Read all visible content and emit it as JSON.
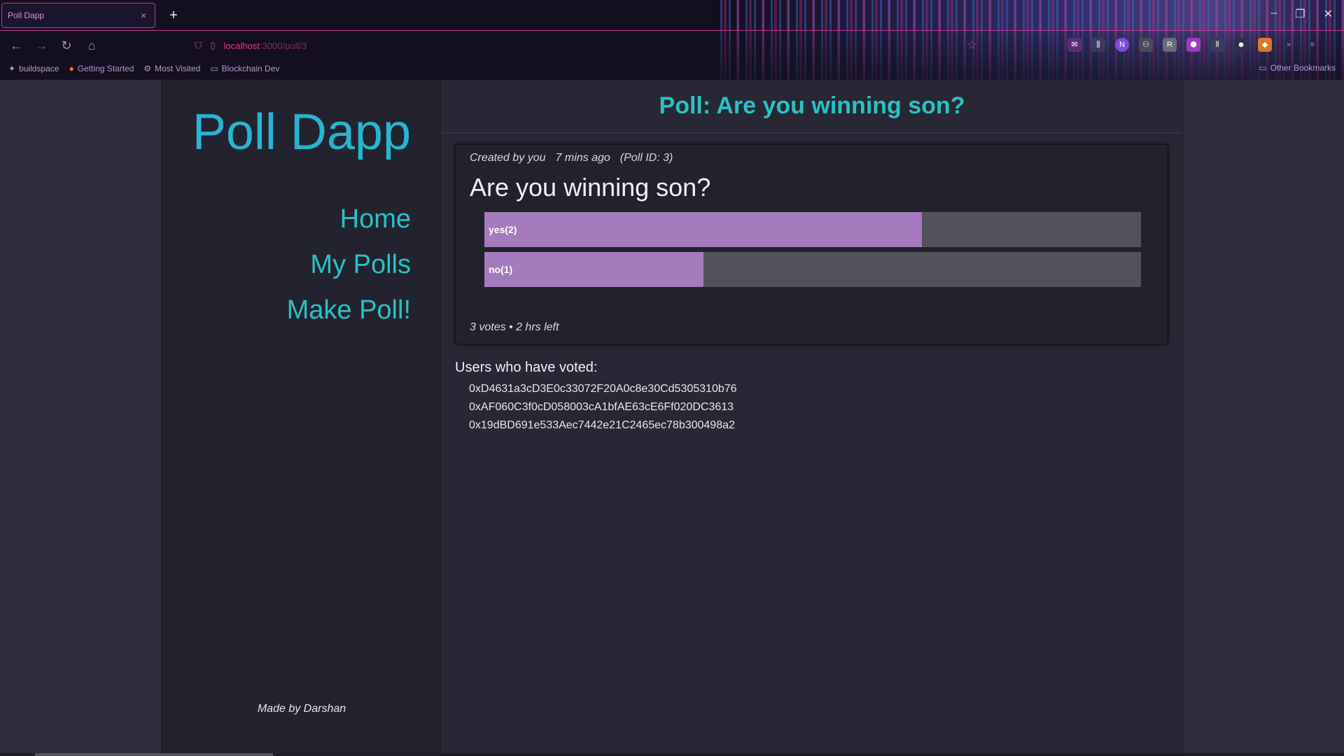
{
  "browser": {
    "tab_title": "Poll Dapp",
    "tab_close": "×",
    "new_tab": "+",
    "url_host": "localhost",
    "url_path": ":3000/poll/3",
    "bookmarks": [
      {
        "label": "buildspace",
        "icon": "unicorn-icon"
      },
      {
        "label": "Getting Started",
        "icon": "firefox-icon"
      },
      {
        "label": "Most Visited",
        "icon": "gear-icon"
      },
      {
        "label": "Blockchain Dev",
        "icon": "folder-icon"
      }
    ],
    "other_bookmarks": "Other Bookmarks",
    "accent": "#c23a8f"
  },
  "sidebar": {
    "brand": "Poll Dapp",
    "nav": [
      {
        "label": "Home"
      },
      {
        "label": "My Polls"
      },
      {
        "label": "Make Poll!"
      }
    ],
    "footer": "Made by Darshan"
  },
  "main": {
    "header_title": "Poll: Are you winning son?",
    "poll": {
      "created_by": "Created by you",
      "created_ago": "7 mins ago",
      "poll_id": "(Poll ID: 3)",
      "question": "Are you winning son?",
      "options": [
        {
          "label": "yes(2)",
          "votes": 2,
          "fraction": 0.6667
        },
        {
          "label": "no(1)",
          "votes": 1,
          "fraction": 0.3333
        }
      ],
      "footer": "3 votes • 2 hrs left"
    },
    "voters_title": "Users who have voted:",
    "voters": [
      "0xD4631a3cD3E0c33072F20A0c8e30Cd5305310b76",
      "0xAF060C3f0cD058003cA1bfAE63cE6Ff020DC3613",
      "0x19dBD691e533Aec7442e21C2465ec78b300498a2"
    ]
  },
  "colors": {
    "brand": "#27b5d2",
    "nav": "#2ac2c6",
    "bar_fill": "#a57abe",
    "bar_track": "#52525a"
  }
}
